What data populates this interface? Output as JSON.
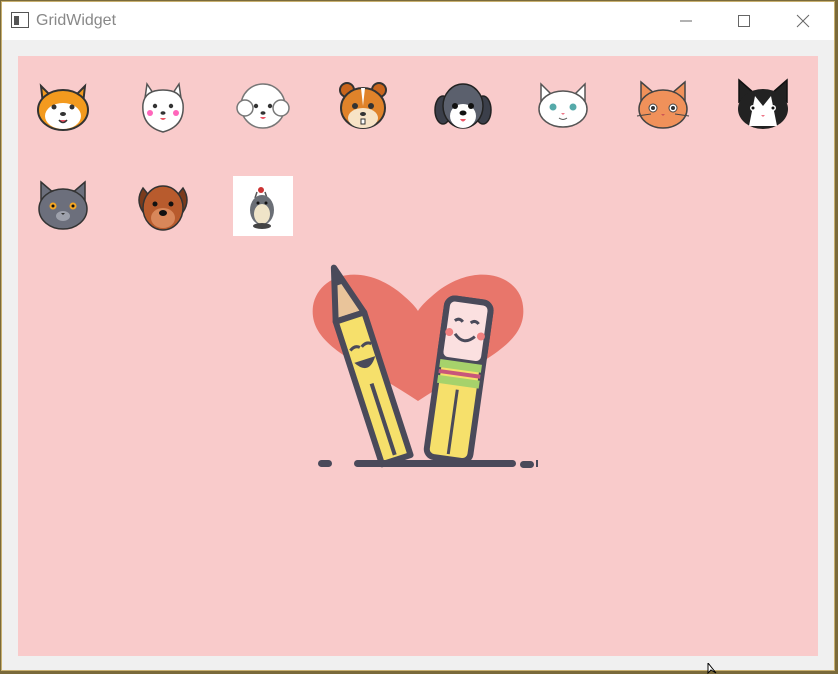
{
  "window": {
    "title": "GridWidget"
  },
  "grid": {
    "items": [
      {
        "icon": "shiba-dog-face-icon"
      },
      {
        "icon": "samoyed-dog-face-icon"
      },
      {
        "icon": "bichon-dog-face-icon"
      },
      {
        "icon": "chipmunk-face-icon"
      },
      {
        "icon": "shih-tzu-dog-face-icon"
      },
      {
        "icon": "white-cat-face-icon"
      },
      {
        "icon": "orange-cat-face-icon"
      },
      {
        "icon": "tuxedo-cat-face-icon"
      },
      {
        "icon": "gray-cat-face-icon"
      },
      {
        "icon": "mastiff-dog-face-icon"
      },
      {
        "icon": "totoro-icon",
        "selected": true
      }
    ]
  },
  "illustration": {
    "icon": "pencils-heart-illustration"
  },
  "colors": {
    "canvas": "#f9cbcb",
    "heart": "#e8766b",
    "pencil": "#f6e06b",
    "outline": "#4a4a5a"
  }
}
